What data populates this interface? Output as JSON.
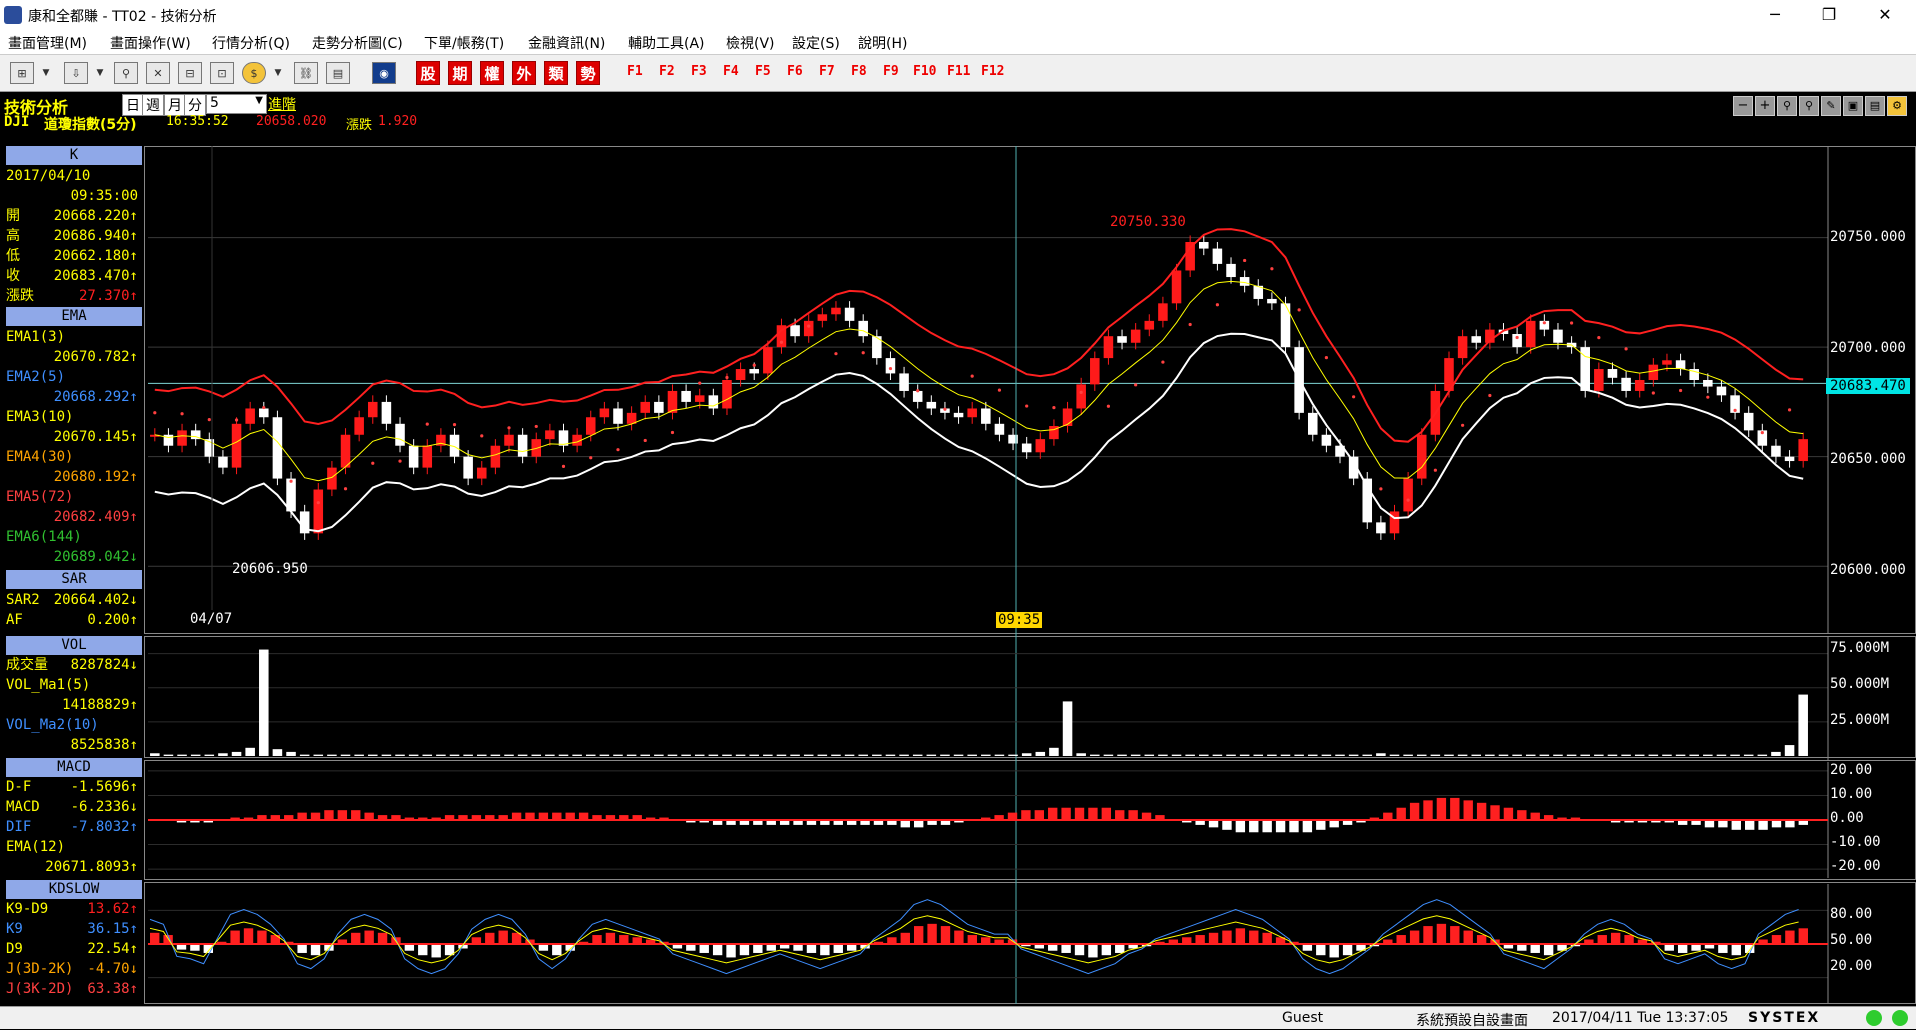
{
  "window": {
    "title": "康和全都賺 - TT02 - 技術分析",
    "min": "─",
    "max": "❐",
    "close": "✕"
  },
  "menu": [
    "畫面管理(M)",
    "畫面操作(W)",
    "行情分析(Q)",
    "走勢分析圖(C)",
    "下單/帳務(T)",
    "金融資訊(N)",
    "輔助工具(A)",
    "檢視(V)",
    "設定(S)",
    "說明(H)"
  ],
  "toolbar": {
    "category_buttons": [
      "股",
      "期",
      "權",
      "外",
      "類",
      "勢"
    ],
    "fkeys": [
      "F1",
      "F2",
      "F3",
      "F4",
      "F5",
      "F6",
      "F7",
      "F8",
      "F9",
      "F10",
      "F11",
      "F12"
    ]
  },
  "header": {
    "section_title": "技術分析",
    "period_options": [
      "日",
      "週",
      "月",
      "分"
    ],
    "period_value": "5",
    "advanced_label": "進階",
    "symbol": "DJI",
    "symbol_name": "道瓊指數(5分)",
    "time": "16:35:52",
    "price": "20658.020",
    "change_label": "漲跌",
    "change": "1.920"
  },
  "k_panel": {
    "title": "K",
    "date": "2017/04/10",
    "time": "09:35:00",
    "rows": [
      {
        "k": "開",
        "v": "20668.220↑"
      },
      {
        "k": "高",
        "v": "20686.940↑"
      },
      {
        "k": "低",
        "v": "20662.180↑"
      },
      {
        "k": "收",
        "v": "20683.470↑"
      },
      {
        "k": "漲跌",
        "v": "27.370↑"
      }
    ],
    "ema_title": "EMA",
    "ema_rows": [
      {
        "k": "EMA1(3)",
        "v": "20670.782↑"
      },
      {
        "k": "EMA2(5)",
        "v": "20668.292↑"
      },
      {
        "k": "EMA3(10)",
        "v": "20670.145↑"
      },
      {
        "k": "EMA4(30)",
        "v": "20680.192↑"
      },
      {
        "k": "EMA5(72)",
        "v": "20682.409↑"
      },
      {
        "k": "EMA6(144)",
        "v": "20689.042↓"
      }
    ],
    "sar_title": "SAR",
    "sar_rows": [
      {
        "k": "SAR2",
        "v": "20664.402↓"
      },
      {
        "k": "AF",
        "v": "0.200↑"
      }
    ]
  },
  "vol_panel": {
    "title": "VOL",
    "rows": [
      {
        "k": "成交量",
        "v": "8287824↓"
      },
      {
        "k": "VOL_Ma1(5)",
        "v": ""
      },
      {
        "k": "",
        "v": "14188829↑"
      },
      {
        "k": "VOL_Ma2(10)",
        "v": ""
      },
      {
        "k": "",
        "v": "8525838↑"
      }
    ]
  },
  "macd_panel": {
    "title": "MACD",
    "rows": [
      {
        "k": "D-F",
        "v": "-1.5696↑"
      },
      {
        "k": "MACD",
        "v": "-6.2336↓"
      },
      {
        "k": "DIF",
        "v": "-7.8032↑"
      },
      {
        "k": "EMA(12)",
        "v": ""
      },
      {
        "k": "",
        "v": "20671.8093↑"
      }
    ]
  },
  "kd_panel": {
    "title": "KDSLOW",
    "rows": [
      {
        "k": "K9-D9",
        "v": "13.62↑"
      },
      {
        "k": "K9",
        "v": "36.15↑"
      },
      {
        "k": "D9",
        "v": "22.54↑"
      },
      {
        "k": "J(3D-2K)",
        "v": "-4.70↓"
      },
      {
        "k": "J(3K-2D)",
        "v": "63.38↑"
      }
    ]
  },
  "chart_data": [
    {
      "type": "candlestick",
      "y_ticks": [
        "20750.000",
        "20700.000",
        "20650.000",
        "20600.000"
      ],
      "y_tick_values": [
        20750,
        20700,
        20650,
        20600
      ],
      "ylim": [
        20580,
        20790
      ],
      "cursor_value": "20683.470",
      "high_annotation": "20750.330",
      "low_annotation": "20606.950",
      "x_labels": [
        "04/07"
      ],
      "cursor_time": "09:35",
      "closes": [
        20660,
        20655,
        20662,
        20658,
        20650,
        20645,
        20665,
        20672,
        20668,
        20640,
        20625,
        20615,
        20635,
        20645,
        20660,
        20668,
        20675,
        20665,
        20655,
        20645,
        20655,
        20660,
        20650,
        20640,
        20645,
        20655,
        20660,
        20650,
        20658,
        20662,
        20655,
        20660,
        20668,
        20672,
        20665,
        20670,
        20675,
        20670,
        20680,
        20675,
        20678,
        20672,
        20685,
        20690,
        20688,
        20700,
        20710,
        20705,
        20712,
        20715,
        20718,
        20712,
        20705,
        20695,
        20688,
        20680,
        20675,
        20672,
        20670,
        20668,
        20672,
        20665,
        20660,
        20656,
        20652,
        20658,
        20664,
        20672,
        20683,
        20695,
        20705,
        20702,
        20708,
        20712,
        20720,
        20735,
        20748,
        20745,
        20738,
        20732,
        20728,
        20722,
        20720,
        20700,
        20670,
        20660,
        20655,
        20650,
        20640,
        20620,
        20615,
        20625,
        20640,
        20660,
        20680,
        20695,
        20705,
        20702,
        20708,
        20706,
        20700,
        20712,
        20708,
        20702,
        20700,
        20680,
        20690,
        20686,
        20680,
        20685,
        20692,
        20694,
        20690,
        20685,
        20682,
        20678,
        20670,
        20662,
        20655,
        20650,
        20648,
        20658
      ]
    },
    {
      "type": "bar",
      "title": "VOL",
      "y_ticks": [
        "75.000M",
        "50.000M",
        "25.000M"
      ],
      "y_tick_values": [
        75,
        50,
        25
      ],
      "ylim": [
        0,
        85
      ],
      "values": [
        2,
        1,
        1,
        1,
        1,
        2,
        3,
        6,
        78,
        5,
        3,
        1,
        1,
        1,
        1,
        1,
        1,
        1,
        1,
        1,
        1,
        1,
        1,
        1,
        1,
        1,
        1,
        1,
        1,
        1,
        1,
        1,
        1,
        1,
        1,
        1,
        1,
        1,
        1,
        1,
        1,
        1,
        1,
        1,
        1,
        1,
        1,
        1,
        1,
        1,
        1,
        1,
        1,
        1,
        1,
        1,
        1,
        1,
        1,
        1,
        1,
        1,
        1,
        1,
        2,
        3,
        6,
        40,
        2,
        1,
        1,
        1,
        1,
        1,
        1,
        1,
        1,
        1,
        1,
        1,
        1,
        1,
        1,
        1,
        1,
        1,
        1,
        1,
        1,
        1,
        2,
        1,
        1,
        1,
        1,
        1,
        1,
        1,
        1,
        1,
        1,
        1,
        1,
        1,
        1,
        1,
        1,
        1,
        1,
        1,
        1,
        1,
        1,
        1,
        1,
        1,
        1,
        1,
        1,
        3,
        8,
        45
      ]
    },
    {
      "type": "bar",
      "title": "MACD",
      "y_ticks": [
        "20.00",
        "10.00",
        "0.00",
        "-10.00",
        "-20.00"
      ],
      "y_tick_values": [
        20,
        10,
        0,
        -10,
        -20
      ],
      "ylim": [
        -22,
        22
      ],
      "values": [
        0,
        0,
        -1,
        -1,
        -1,
        0,
        1,
        1,
        2,
        2,
        2,
        3,
        3,
        4,
        4,
        4,
        3,
        2,
        2,
        1,
        1,
        1,
        2,
        2,
        2,
        2,
        2,
        3,
        3,
        3,
        3,
        3,
        3,
        2,
        2,
        2,
        2,
        1,
        1,
        0,
        -1,
        -1,
        -2,
        -2,
        -2,
        -2,
        -2,
        -2,
        -2,
        -2,
        -2,
        -2,
        -2,
        -2,
        -2,
        -2,
        -3,
        -3,
        -2,
        -2,
        -1,
        0,
        1,
        2,
        3,
        4,
        4,
        5,
        5,
        5,
        5,
        5,
        4,
        4,
        3,
        2,
        0,
        -1,
        -2,
        -3,
        -4,
        -5,
        -5,
        -5,
        -5,
        -5,
        -5,
        -4,
        -3,
        -2,
        -1,
        1,
        3,
        5,
        7,
        8,
        9,
        9,
        8,
        7,
        6,
        5,
        4,
        3,
        2,
        1,
        1,
        0,
        0,
        -1,
        -1,
        -1,
        -1,
        -1,
        -2,
        -2,
        -3,
        -3,
        -4,
        -4,
        -4,
        -3,
        -3,
        -2
      ]
    },
    {
      "type": "bar",
      "title": "KDSLOW",
      "y_ticks": [
        "80.00",
        "50.00",
        "20.00"
      ],
      "y_tick_values": [
        80,
        50,
        20
      ],
      "ylim": [
        0,
        100
      ],
      "values": [
        10,
        8,
        -5,
        -6,
        -8,
        2,
        12,
        14,
        12,
        8,
        2,
        -8,
        -10,
        -6,
        4,
        10,
        12,
        10,
        6,
        -6,
        -10,
        -12,
        -10,
        -4,
        6,
        10,
        12,
        10,
        4,
        -6,
        -10,
        -6,
        2,
        8,
        10,
        8,
        6,
        4,
        2,
        -4,
        -6,
        -8,
        -10,
        -12,
        -10,
        -8,
        -6,
        -4,
        -6,
        -8,
        -10,
        -8,
        -6,
        -4,
        2,
        6,
        10,
        16,
        18,
        16,
        12,
        8,
        6,
        4,
        4,
        -2,
        -4,
        -6,
        -8,
        -10,
        -12,
        -10,
        -8,
        -4,
        -2,
        2,
        4,
        6,
        8,
        10,
        12,
        14,
        12,
        10,
        6,
        2,
        -6,
        -10,
        -12,
        -10,
        -6,
        -2,
        4,
        8,
        12,
        16,
        18,
        16,
        12,
        8,
        4,
        -4,
        -6,
        -8,
        -10,
        -6,
        -2,
        4,
        8,
        10,
        8,
        4,
        2,
        -6,
        -8,
        -6,
        -4,
        -8,
        -10,
        -8,
        4,
        8,
        12,
        14
      ]
    }
  ],
  "status": {
    "user": "Guest",
    "screen": "系統預設自設畫面",
    "datetime": "2017/04/11 Tue 13:37:05",
    "brand": "SYSTEX"
  },
  "colors": {
    "up": "#ff1a1a",
    "down": "#ffffff",
    "accent": "#8fa8e8",
    "label": "#ffff00",
    "grid": "#444444"
  }
}
